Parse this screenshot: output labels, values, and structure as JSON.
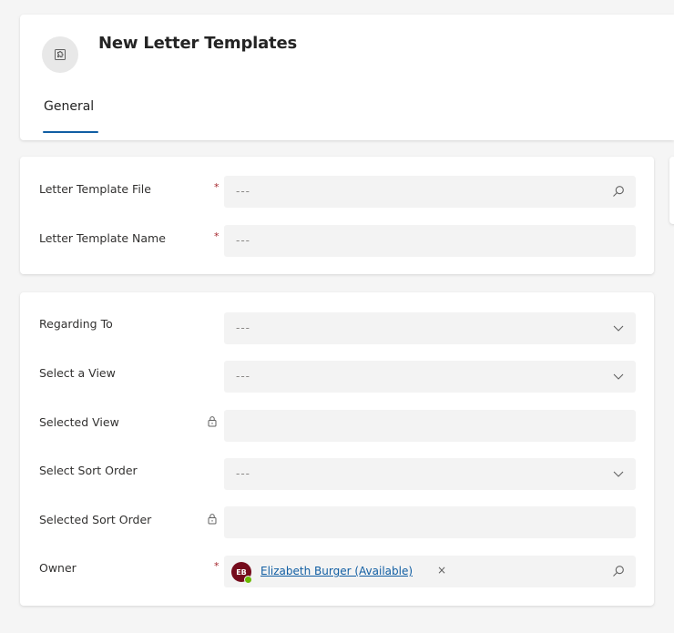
{
  "header": {
    "title": "New Letter Templates",
    "entity_icon": "puzzle-icon",
    "tabs": [
      {
        "label": "General",
        "active": true
      }
    ]
  },
  "section1": {
    "fields": [
      {
        "label": "Letter Template File",
        "required": "*",
        "value": "---",
        "trailing_icon": "search-icon"
      },
      {
        "label": "Letter Template Name",
        "required": "*",
        "value": "---"
      }
    ]
  },
  "section2": {
    "fields": [
      {
        "label": "Regarding To",
        "value": "---",
        "trailing_icon": "chevron-down-icon"
      },
      {
        "label": "Select a View",
        "value": "---",
        "trailing_icon": "chevron-down-icon"
      },
      {
        "label": "Selected View",
        "locked": true,
        "value": ""
      },
      {
        "label": "Select Sort Order",
        "value": "---",
        "trailing_icon": "chevron-down-icon"
      },
      {
        "label": "Selected Sort Order",
        "locked": true,
        "value": ""
      },
      {
        "label": "Owner",
        "required": "*",
        "owner_initials": "EB",
        "owner_name": "Elizabeth Burger (Available)",
        "remove_glyph": "×",
        "trailing_icon": "search-icon"
      }
    ]
  },
  "colors": {
    "accent": "#115ea3",
    "required": "#a4262c",
    "avatar": "#750b1c",
    "presence_available": "#6bb700"
  }
}
